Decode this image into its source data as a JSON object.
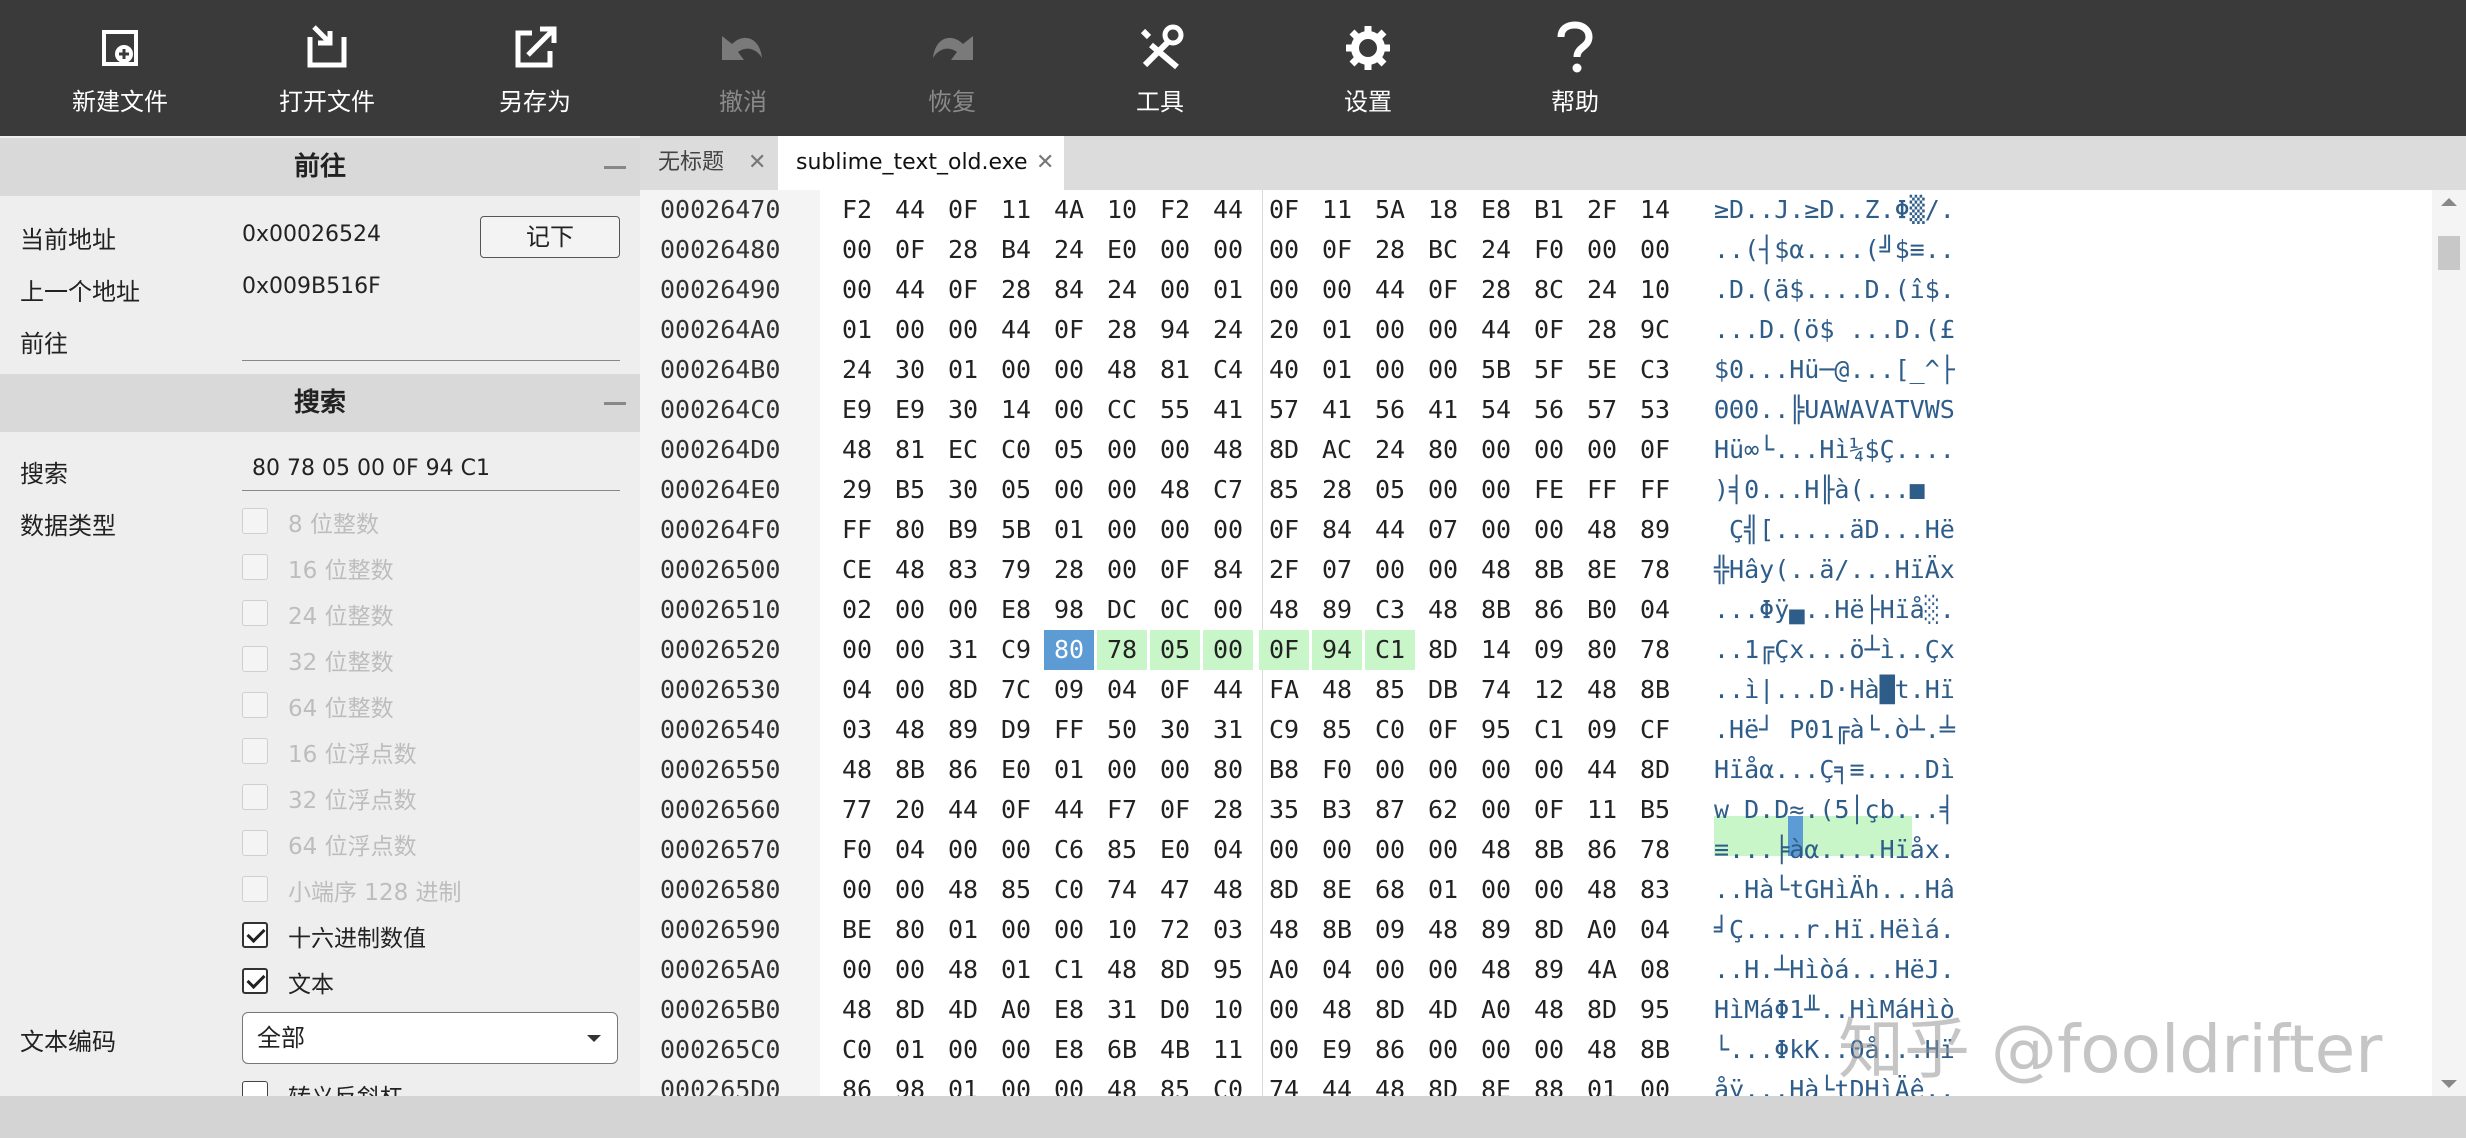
{
  "toolbar": {
    "new_file": "新建文件",
    "open_file": "打开文件",
    "save_as": "另存为",
    "undo": "撤消",
    "redo": "恢复",
    "tools": "工具",
    "settings": "设置",
    "help": "帮助"
  },
  "goto": {
    "title": "前往",
    "current_label": "当前地址",
    "current_value": "0x00026524",
    "record_button": "记下",
    "previous_label": "上一个地址",
    "previous_value": "0x009B516F",
    "goto_label": "前往",
    "goto_value": ""
  },
  "search": {
    "title": "搜索",
    "search_label": "搜索",
    "search_value": "80 78 05 00 0F 94 C1",
    "datatype_label": "数据类型",
    "options": [
      {
        "label": "8 位整数",
        "checked": false
      },
      {
        "label": "16 位整数",
        "checked": false
      },
      {
        "label": "24 位整数",
        "checked": false
      },
      {
        "label": "32 位整数",
        "checked": false
      },
      {
        "label": "64 位整数",
        "checked": false
      },
      {
        "label": "16 位浮点数",
        "checked": false
      },
      {
        "label": "32 位浮点数",
        "checked": false
      },
      {
        "label": "64 位浮点数",
        "checked": false
      },
      {
        "label": "小端序 128 进制",
        "checked": false
      },
      {
        "label": "十六进制数值",
        "checked": true
      },
      {
        "label": "文本",
        "checked": true
      }
    ],
    "encoding_label": "文本编码",
    "encoding_value": "全部",
    "last_option": "转义反斜杠"
  },
  "tabs": [
    {
      "label": "无标题",
      "active": false
    },
    {
      "label": "sublime_text_old.exe",
      "active": true
    }
  ],
  "hex_rows": [
    {
      "addr": "00026470",
      "bytes": [
        "F2",
        "44",
        "0F",
        "11",
        "4A",
        "10",
        "F2",
        "44",
        "0F",
        "11",
        "5A",
        "18",
        "E8",
        "B1",
        "2F",
        "14"
      ],
      "ascii": "≥D..J.≥D..Z.Φ▒/."
    },
    {
      "addr": "00026480",
      "bytes": [
        "00",
        "0F",
        "28",
        "B4",
        "24",
        "E0",
        "00",
        "00",
        "00",
        "0F",
        "28",
        "BC",
        "24",
        "F0",
        "00",
        "00"
      ],
      "ascii": "..(┤$α....(╝$≡.."
    },
    {
      "addr": "00026490",
      "bytes": [
        "00",
        "44",
        "0F",
        "28",
        "84",
        "24",
        "00",
        "01",
        "00",
        "00",
        "44",
        "0F",
        "28",
        "8C",
        "24",
        "10"
      ],
      "ascii": ".D.(ä$....D.(î$."
    },
    {
      "addr": "000264A0",
      "bytes": [
        "01",
        "00",
        "00",
        "44",
        "0F",
        "28",
        "94",
        "24",
        "20",
        "01",
        "00",
        "00",
        "44",
        "0F",
        "28",
        "9C"
      ],
      "ascii": "...D.(ö$ ...D.(£"
    },
    {
      "addr": "000264B0",
      "bytes": [
        "24",
        "30",
        "01",
        "00",
        "00",
        "48",
        "81",
        "C4",
        "40",
        "01",
        "00",
        "00",
        "5B",
        "5F",
        "5E",
        "C3"
      ],
      "ascii": "$0...Hü─@...[_^├"
    },
    {
      "addr": "000264C0",
      "bytes": [
        "E9",
        "E9",
        "30",
        "14",
        "00",
        "CC",
        "55",
        "41",
        "57",
        "41",
        "56",
        "41",
        "54",
        "56",
        "57",
        "53"
      ],
      "ascii": "ΘΘ0..╠UAWAVATVWS"
    },
    {
      "addr": "000264D0",
      "bytes": [
        "48",
        "81",
        "EC",
        "C0",
        "05",
        "00",
        "00",
        "48",
        "8D",
        "AC",
        "24",
        "80",
        "00",
        "00",
        "00",
        "0F"
      ],
      "ascii": "Hü∞└...Hì¼$Ç...."
    },
    {
      "addr": "000264E0",
      "bytes": [
        "29",
        "B5",
        "30",
        "05",
        "00",
        "00",
        "48",
        "C7",
        "85",
        "28",
        "05",
        "00",
        "00",
        "FE",
        "FF",
        "FF"
      ],
      "ascii": ")╡0...H╟à(...■  "
    },
    {
      "addr": "000264F0",
      "bytes": [
        "FF",
        "80",
        "B9",
        "5B",
        "01",
        "00",
        "00",
        "00",
        "0F",
        "84",
        "44",
        "07",
        "00",
        "00",
        "48",
        "89"
      ],
      "ascii": " Ç╣[.....äD...Hë"
    },
    {
      "addr": "00026500",
      "bytes": [
        "CE",
        "48",
        "83",
        "79",
        "28",
        "00",
        "0F",
        "84",
        "2F",
        "07",
        "00",
        "00",
        "48",
        "8B",
        "8E",
        "78"
      ],
      "ascii": "╬Hây(..ä/...HïÄx"
    },
    {
      "addr": "00026510",
      "bytes": [
        "02",
        "00",
        "00",
        "E8",
        "98",
        "DC",
        "0C",
        "00",
        "48",
        "89",
        "C3",
        "48",
        "8B",
        "86",
        "B0",
        "04"
      ],
      "ascii": "...Φÿ▄..Hë├Hïå░."
    },
    {
      "addr": "00026520",
      "bytes": [
        "00",
        "00",
        "31",
        "C9",
        "80",
        "78",
        "05",
        "00",
        "0F",
        "94",
        "C1",
        "8D",
        "14",
        "09",
        "80",
        "78"
      ],
      "ascii": "..1╔Çx...ö┴ì..Çx"
    },
    {
      "addr": "00026530",
      "bytes": [
        "04",
        "00",
        "8D",
        "7C",
        "09",
        "04",
        "0F",
        "44",
        "FA",
        "48",
        "85",
        "DB",
        "74",
        "12",
        "48",
        "8B"
      ],
      "ascii": "..ì|...D·Hà█t.Hï"
    },
    {
      "addr": "00026540",
      "bytes": [
        "03",
        "48",
        "89",
        "D9",
        "FF",
        "50",
        "30",
        "31",
        "C9",
        "85",
        "C0",
        "0F",
        "95",
        "C1",
        "09",
        "CF"
      ],
      "ascii": ".Hë┘ P01╔à└.ò┴.╧"
    },
    {
      "addr": "00026550",
      "bytes": [
        "48",
        "8B",
        "86",
        "E0",
        "01",
        "00",
        "00",
        "80",
        "B8",
        "F0",
        "00",
        "00",
        "00",
        "00",
        "44",
        "8D"
      ],
      "ascii": "Hïåα...Ç╕≡....Dì"
    },
    {
      "addr": "00026560",
      "bytes": [
        "77",
        "20",
        "44",
        "0F",
        "44",
        "F7",
        "0F",
        "28",
        "35",
        "B3",
        "87",
        "62",
        "00",
        "0F",
        "11",
        "B5"
      ],
      "ascii": "w D.D≈.(5│çb...╡"
    },
    {
      "addr": "00026570",
      "bytes": [
        "F0",
        "04",
        "00",
        "00",
        "C6",
        "85",
        "E0",
        "04",
        "00",
        "00",
        "00",
        "00",
        "48",
        "8B",
        "86",
        "78"
      ],
      "ascii": "≡...╞àα....Hïåx."
    },
    {
      "addr": "00026580",
      "bytes": [
        "00",
        "00",
        "48",
        "85",
        "C0",
        "74",
        "47",
        "48",
        "8D",
        "8E",
        "68",
        "01",
        "00",
        "00",
        "48",
        "83"
      ],
      "ascii": "..Hà└tGHìÄh...Hâ"
    },
    {
      "addr": "00026590",
      "bytes": [
        "BE",
        "80",
        "01",
        "00",
        "00",
        "10",
        "72",
        "03",
        "48",
        "8B",
        "09",
        "48",
        "89",
        "8D",
        "A0",
        "04"
      ],
      "ascii": "╛Ç....r.Hï.Hëìá."
    },
    {
      "addr": "000265A0",
      "bytes": [
        "00",
        "00",
        "48",
        "01",
        "C1",
        "48",
        "8D",
        "95",
        "A0",
        "04",
        "00",
        "00",
        "48",
        "89",
        "4A",
        "08"
      ],
      "ascii": "..H.┴Hìòá...HëJ."
    },
    {
      "addr": "000265B0",
      "bytes": [
        "48",
        "8D",
        "4D",
        "A0",
        "E8",
        "31",
        "D0",
        "10",
        "00",
        "48",
        "8D",
        "4D",
        "A0",
        "48",
        "8D",
        "95"
      ],
      "ascii": "HìMáΦ1╨..HìMáHìò"
    },
    {
      "addr": "000265C0",
      "bytes": [
        "C0",
        "01",
        "00",
        "00",
        "E8",
        "6B",
        "4B",
        "11",
        "00",
        "E9",
        "86",
        "00",
        "00",
        "00",
        "48",
        "8B"
      ],
      "ascii": "└...ΦkK..Θå...Hï"
    },
    {
      "addr": "000265D0",
      "bytes": [
        "86",
        "98",
        "01",
        "00",
        "00",
        "48",
        "85",
        "C0",
        "74",
        "44",
        "48",
        "8D",
        "8E",
        "88",
        "01",
        "00"
      ],
      "ascii": "åÿ...Hà└tDHìÄê.."
    }
  ],
  "watermark": "知乎 @fooldrifter"
}
